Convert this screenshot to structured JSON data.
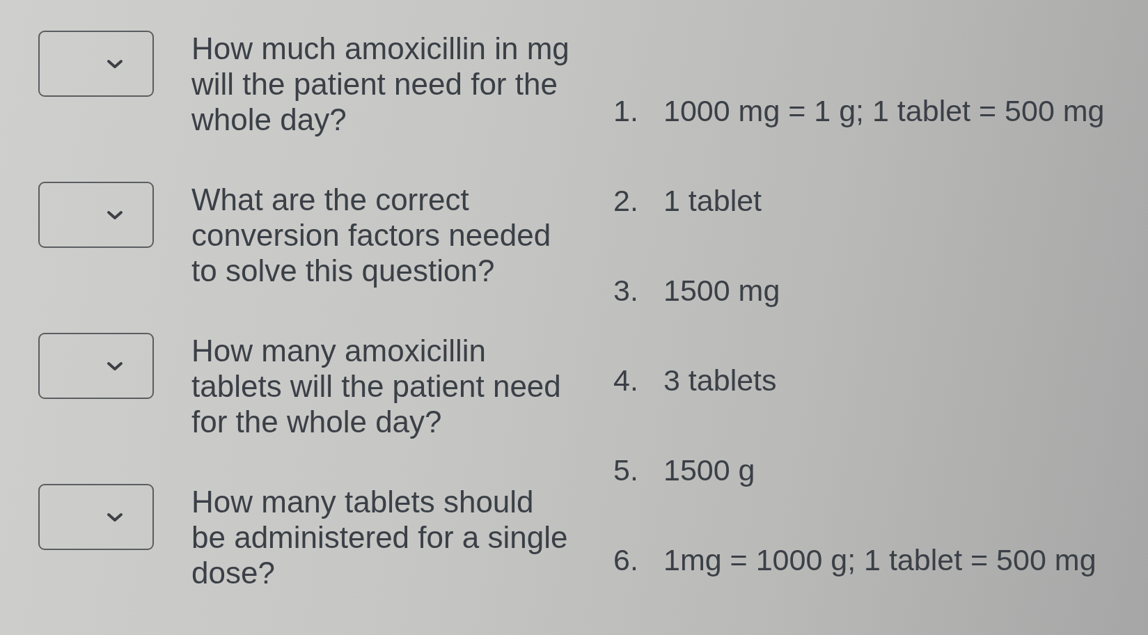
{
  "questions": [
    {
      "prompt": "How much amoxicillin in mg will the patient need for the whole day?"
    },
    {
      "prompt": "What are the correct conversion factors needed to solve this question?"
    },
    {
      "prompt": "How many amoxicillin tablets will the patient need for the whole day?"
    },
    {
      "prompt": "How many tablets should be administered for a single dose?"
    }
  ],
  "answers": [
    {
      "number": "1.",
      "text": "1000 mg = 1 g; 1 tablet = 500 mg"
    },
    {
      "number": "2.",
      "text": "1 tablet"
    },
    {
      "number": "3.",
      "text": "1500 mg"
    },
    {
      "number": "4.",
      "text": "3 tablets"
    },
    {
      "number": "5.",
      "text": "1500 g"
    },
    {
      "number": "6.",
      "text": "1mg = 1000 g; 1 tablet = 500 mg"
    }
  ]
}
